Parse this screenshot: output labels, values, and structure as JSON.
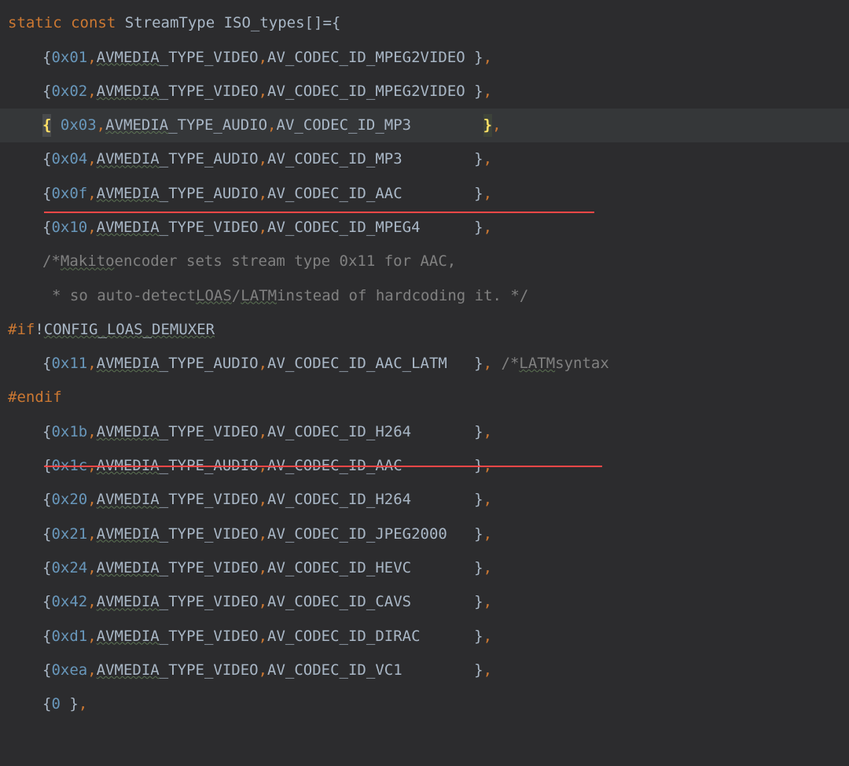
{
  "decl": {
    "static_kw": "static",
    "const_kw": "const",
    "typeName": "StreamType",
    "varName": "ISO_types",
    "arraySuffix": "[]",
    "equals": " = ",
    "open": "{"
  },
  "rows": {
    "r1_hex": "0x01",
    "r1_media": "AVMEDIA",
    "r1_media_sfx": "_TYPE_VIDEO",
    "r1_codec": "AV_CODEC_ID_MPEG2VIDEO",
    "r2_hex": "0x02",
    "r2_media": "AVMEDIA",
    "r2_media_sfx": "_TYPE_VIDEO",
    "r2_codec": "AV_CODEC_ID_MPEG2VIDEO",
    "r3_hex": "0x03",
    "r3_media": "AVMEDIA",
    "r3_media_sfx": "_TYPE_AUDIO",
    "r3_codec": "AV_CODEC_ID_MP3",
    "r4_hex": "0x04",
    "r4_media": "AVMEDIA",
    "r4_media_sfx": "_TYPE_AUDIO",
    "r4_codec": "AV_CODEC_ID_MP3",
    "r5_hex": "0x0f",
    "r5_media": "AVMEDIA",
    "r5_media_sfx": "_TYPE_AUDIO",
    "r5_codec": "AV_CODEC_ID_AAC",
    "r6_hex": "0x10",
    "r6_media": "AVMEDIA",
    "r6_media_sfx": "_TYPE_VIDEO",
    "r6_codec": "AV_CODEC_ID_MPEG4",
    "r7_hex": "0x11",
    "r7_media": "AVMEDIA",
    "r7_media_sfx": "_TYPE_AUDIO",
    "r7_codec": "AV_CODEC_ID_AAC_LATM",
    "r8_hex": "0x1b",
    "r8_media": "AVMEDIA",
    "r8_media_sfx": "_TYPE_VIDEO",
    "r8_codec": "AV_CODEC_ID_H264",
    "r9_hex": "0x1c",
    "r9_media": "AVMEDIA",
    "r9_media_sfx": "_TYPE_AUDIO",
    "r9_codec": "AV_CODEC_ID_AAC",
    "r10_hex": "0x20",
    "r10_media": "AVMEDIA",
    "r10_media_sfx": "_TYPE_VIDEO",
    "r10_codec": "AV_CODEC_ID_H264",
    "r11_hex": "0x21",
    "r11_media": "AVMEDIA",
    "r11_media_sfx": "_TYPE_VIDEO",
    "r11_codec": "AV_CODEC_ID_JPEG2000",
    "r12_hex": "0x24",
    "r12_media": "AVMEDIA",
    "r12_media_sfx": "_TYPE_VIDEO",
    "r12_codec": "AV_CODEC_ID_HEVC",
    "r13_hex": "0x42",
    "r13_media": "AVMEDIA",
    "r13_media_sfx": "_TYPE_VIDEO",
    "r13_codec": "AV_CODEC_ID_CAVS",
    "r14_hex": "0xd1",
    "r14_media": "AVMEDIA",
    "r14_media_sfx": "_TYPE_VIDEO",
    "r14_codec": "AV_CODEC_ID_DIRAC",
    "r15_hex": "0xea",
    "r15_media": "AVMEDIA",
    "r15_media_sfx": "_TYPE_VIDEO",
    "r15_codec": "AV_CODEC_ID_VC1",
    "r16_zero": "0"
  },
  "comment1_a": "/* ",
  "comment1_makito": "Makito",
  "comment1_b": " encoder sets stream type 0x11 for AAC,",
  "comment2_a": " * so auto-detect ",
  "comment2_loas": "LOAS",
  "comment2_slash": "/",
  "comment2_latm": "LATM",
  "comment2_b": " instead of hardcoding it. */",
  "preproc_if_tok": "#if",
  "preproc_bang": " !",
  "preproc_if_cond": "CONFIG_LOAS_DEMUXER",
  "preproc_endif": "#endif",
  "latm_comment_a": "/* ",
  "latm_comment_word": "LATM",
  "latm_comment_b": " syntax",
  "pads": {
    "p_none": " ",
    "p_mpeg2video": " ",
    "p_mp3": "        ",
    "p_aac": "        ",
    "p_mpeg4": "      ",
    "p_aac_latm": "   ",
    "p_latm_pre": " ",
    "p_h264": "       ",
    "p_aac2": "        ",
    "p_h264b": "       ",
    "p_jpeg2000": "   ",
    "p_hevc": "       ",
    "p_cavs": "       ",
    "p_dirac": "      ",
    "p_vc1": "        "
  },
  "sym": {
    "row_open": "{ ",
    "row_open_hl": "{",
    "comma_sp": ", ",
    "pad1": " ",
    "row_close": "}",
    "row_close_comma": ","
  }
}
